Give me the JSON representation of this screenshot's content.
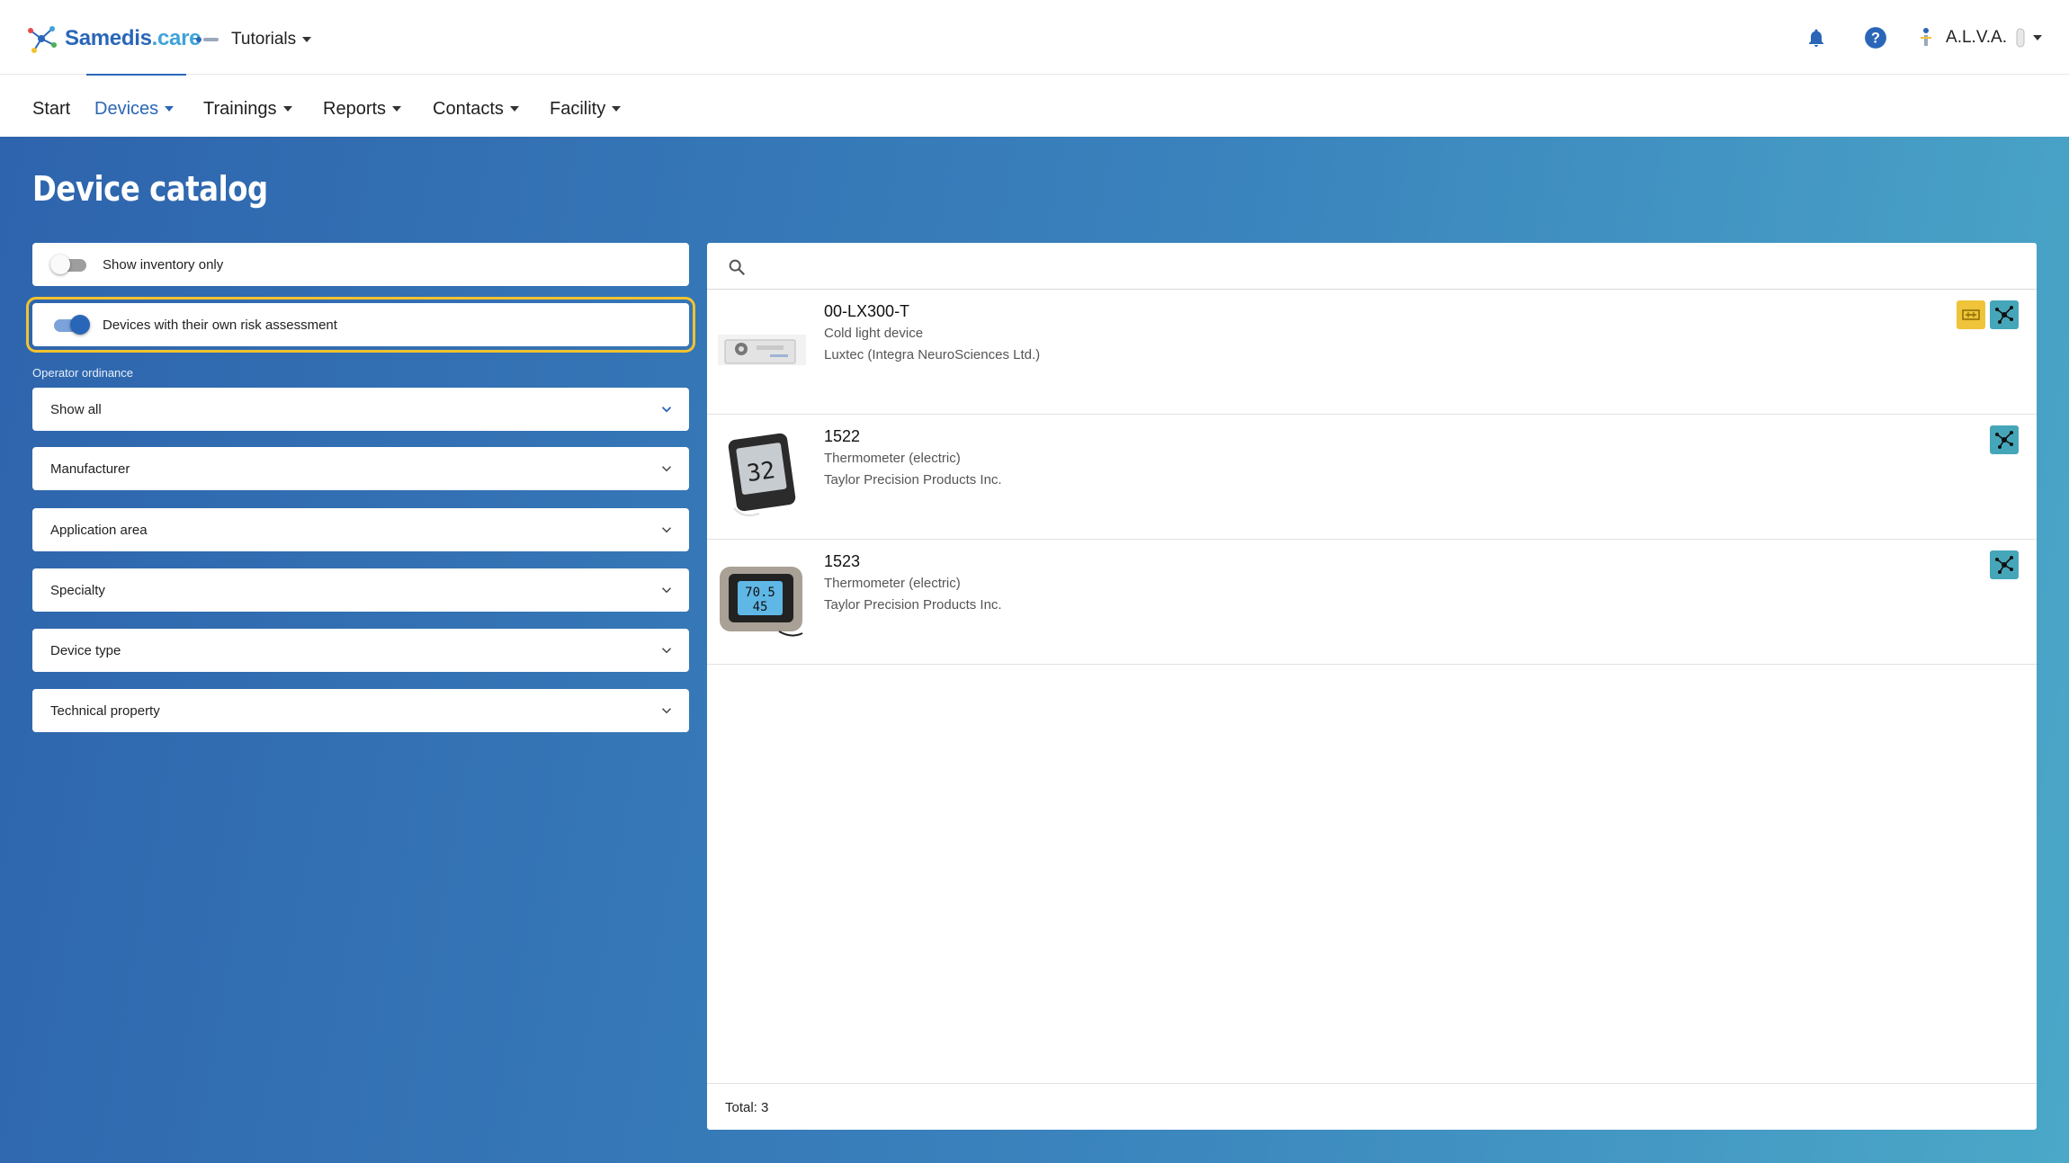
{
  "app": {
    "logo_main": "Samedis",
    "logo_suffix": ".care",
    "tenant": "Tutorials",
    "user": "A.L.V.A."
  },
  "nav": {
    "items": [
      {
        "label": "Start"
      },
      {
        "label": "Devices"
      },
      {
        "label": "Trainings"
      },
      {
        "label": "Reports"
      },
      {
        "label": "Contacts"
      },
      {
        "label": "Facility"
      }
    ],
    "active": "Devices"
  },
  "page": {
    "title": "Device catalog"
  },
  "filters": {
    "inventory_toggle": {
      "label": "Show inventory only",
      "on": false
    },
    "risk_toggle": {
      "label": "Devices with their own risk assessment",
      "on": true
    },
    "operator_label": "Operator ordinance",
    "operator_value": "Show all",
    "selects": [
      {
        "label": "Manufacturer"
      },
      {
        "label": "Application area"
      },
      {
        "label": "Specialty"
      },
      {
        "label": "Device type"
      },
      {
        "label": "Technical property"
      }
    ]
  },
  "search": {
    "placeholder": ""
  },
  "results": [
    {
      "title": "00-LX300-T",
      "type": "Cold light device",
      "manufacturer": "Luxtec (Integra NeuroSciences Ltd.)",
      "badges": [
        "device-manual-icon",
        "network-icon"
      ]
    },
    {
      "title": "1522",
      "type": "Thermometer (electric)",
      "manufacturer": "Taylor Precision Products Inc.",
      "badges": [
        "network-icon"
      ]
    },
    {
      "title": "1523",
      "type": "Thermometer (electric)",
      "manufacturer": "Taylor Precision Products Inc.",
      "badges": [
        "network-icon"
      ]
    }
  ],
  "footer": {
    "total": "Total: 3"
  },
  "colors": {
    "primary": "#2a66b8",
    "highlight": "#f2c230",
    "badge_teal": "#46a6b9",
    "badge_yellow": "#efc43a"
  }
}
